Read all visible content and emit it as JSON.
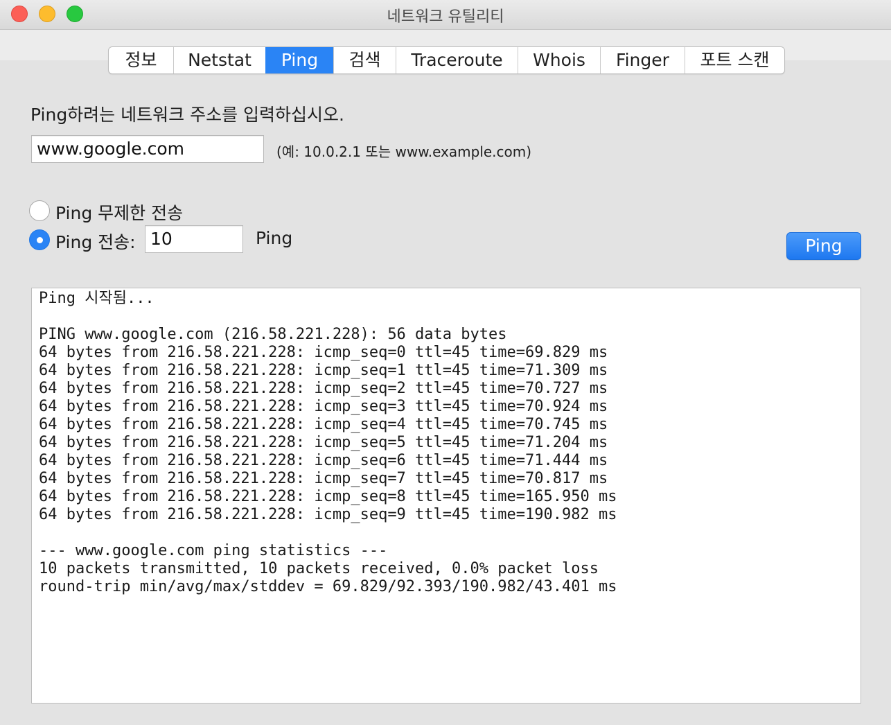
{
  "window": {
    "title": "네트워크 유틸리티"
  },
  "tabs": [
    {
      "label": "정보",
      "active": false
    },
    {
      "label": "Netstat",
      "active": false
    },
    {
      "label": "Ping",
      "active": true
    },
    {
      "label": "검색",
      "active": false
    },
    {
      "label": "Traceroute",
      "active": false
    },
    {
      "label": "Whois",
      "active": false
    },
    {
      "label": "Finger",
      "active": false
    },
    {
      "label": "포트 스캔",
      "active": false
    }
  ],
  "ping": {
    "prompt": "Ping하려는 네트워크 주소를 입력하십시오.",
    "address_value": "www.google.com",
    "example_hint": "(예: 10.0.2.1 또는 www.example.com)",
    "unlimited_label": "Ping 무제한 전송",
    "unlimited_selected": false,
    "count_label": "Ping 전송:",
    "count_selected": true,
    "count_value": "10",
    "count_suffix": "Ping",
    "button_label": "Ping"
  },
  "output": {
    "lines": [
      "Ping 시작됨...",
      "",
      "PING www.google.com (216.58.221.228): 56 data bytes",
      "64 bytes from 216.58.221.228: icmp_seq=0 ttl=45 time=69.829 ms",
      "64 bytes from 216.58.221.228: icmp_seq=1 ttl=45 time=71.309 ms",
      "64 bytes from 216.58.221.228: icmp_seq=2 ttl=45 time=70.727 ms",
      "64 bytes from 216.58.221.228: icmp_seq=3 ttl=45 time=70.924 ms",
      "64 bytes from 216.58.221.228: icmp_seq=4 ttl=45 time=70.745 ms",
      "64 bytes from 216.58.221.228: icmp_seq=5 ttl=45 time=71.204 ms",
      "64 bytes from 216.58.221.228: icmp_seq=6 ttl=45 time=71.444 ms",
      "64 bytes from 216.58.221.228: icmp_seq=7 ttl=45 time=70.817 ms",
      "64 bytes from 216.58.221.228: icmp_seq=8 ttl=45 time=165.950 ms",
      "64 bytes from 216.58.221.228: icmp_seq=9 ttl=45 time=190.982 ms",
      "",
      "--- www.google.com ping statistics ---",
      "10 packets transmitted, 10 packets received, 0.0% packet loss",
      "round-trip min/avg/max/stddev = 69.829/92.393/190.982/43.401 ms"
    ]
  },
  "colors": {
    "accent": "#2a84f5",
    "close": "#fc5f57",
    "minimize": "#fdbc2e",
    "maximize": "#28c840"
  }
}
